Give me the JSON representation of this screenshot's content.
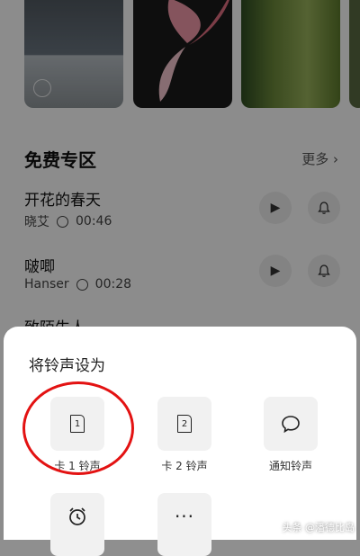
{
  "sections": {
    "free_zone": {
      "title": "免费专区",
      "more_label": "更多"
    }
  },
  "songs": [
    {
      "title": "开花的春天",
      "artist": "晓艾",
      "duration": "00:46"
    },
    {
      "title": "啵唧",
      "artist": "Hanser",
      "duration": "00:28"
    },
    {
      "title": "致陌生人"
    }
  ],
  "sheet": {
    "title": "将铃声设为",
    "options": [
      {
        "label": "卡 1 铃声",
        "icon": "sim1-icon",
        "glyph": "1"
      },
      {
        "label": "卡 2 铃声",
        "icon": "sim2-icon",
        "glyph": "2"
      },
      {
        "label": "通知铃声",
        "icon": "message-icon"
      },
      {
        "label": "",
        "icon": "alarm-icon"
      },
      {
        "label": "",
        "icon": "more-icon",
        "glyph": "···"
      }
    ]
  },
  "watermark": "头条 @潘德比岛",
  "colors": {
    "highlight_ring": "#e31212",
    "scrim": "rgba(0,0,0,0.45)"
  }
}
